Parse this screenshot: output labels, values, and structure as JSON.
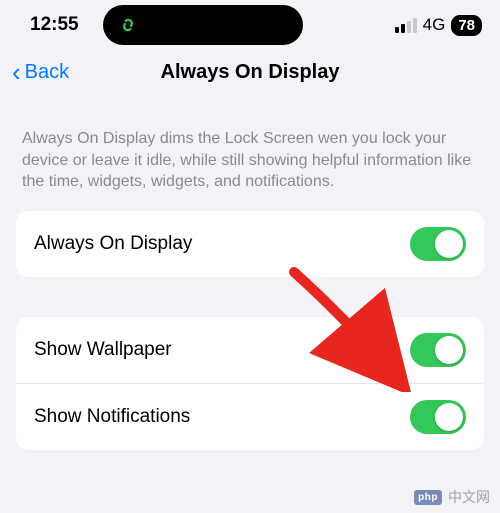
{
  "status": {
    "time": "12:55",
    "cellular": "4G",
    "battery": "78"
  },
  "nav": {
    "back_label": "Back",
    "title": "Always On Display"
  },
  "description": "Always On Display dims the Lock Screen wen you lock your device or leave it idle, while still showing helpful information like the time, widgets, widgets, and notifications.",
  "groups": [
    {
      "rows": [
        {
          "label": "Always On Display",
          "on": true
        }
      ]
    },
    {
      "rows": [
        {
          "label": "Show Wallpaper",
          "on": true
        },
        {
          "label": "Show Notifications",
          "on": true
        }
      ]
    }
  ],
  "watermark": "中文网"
}
